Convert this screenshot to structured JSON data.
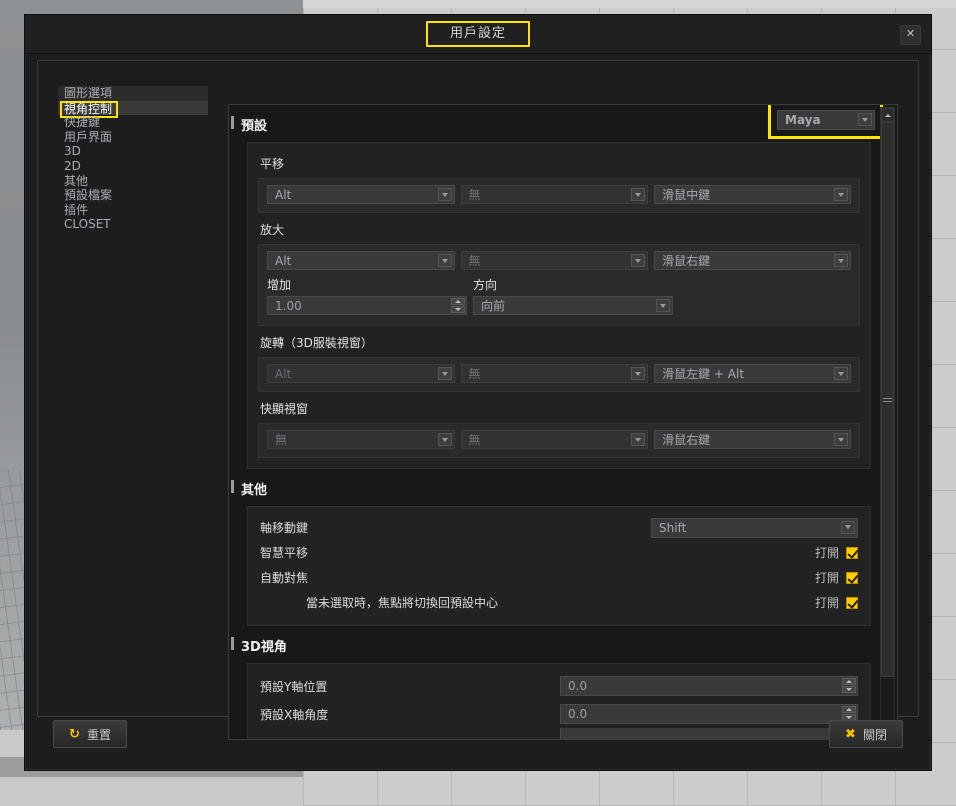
{
  "window": {
    "title": "用戶設定",
    "close_icon": "close-icon",
    "title_highlight_color": "#ffe400"
  },
  "sidebar": {
    "items": [
      {
        "label": "圖形選項",
        "selected": false
      },
      {
        "label": "視角控制",
        "selected": true
      },
      {
        "label": "快捷鍵",
        "selected": false
      },
      {
        "label": "用戶界面",
        "selected": false
      },
      {
        "label": "3D",
        "selected": false
      },
      {
        "label": "2D",
        "selected": false
      },
      {
        "label": "其他",
        "selected": false
      },
      {
        "label": "預設檔案",
        "selected": false
      },
      {
        "label": "插件",
        "selected": false
      },
      {
        "label": "CLOSET",
        "selected": false
      }
    ]
  },
  "preset": {
    "section_title": "預設",
    "value": "Maya",
    "highlight_color": "#ffe400"
  },
  "pan": {
    "title": "平移",
    "modifier1": "Alt",
    "modifier2": "無",
    "mouse": "滑鼠中鍵"
  },
  "zoom": {
    "title": "放大",
    "modifier1": "Alt",
    "modifier2": "無",
    "mouse": "滑鼠右鍵",
    "increment_label": "增加",
    "increment_value": "1.00",
    "direction_label": "方向",
    "direction_value": "向前"
  },
  "rotate": {
    "title": "旋轉（3D服裝視窗）",
    "modifier1": "Alt",
    "modifier2": "無",
    "mouse": "滑鼠左鍵 + Alt"
  },
  "popup": {
    "title": "快顯視窗",
    "modifier1": "無",
    "modifier2": "無",
    "mouse": "滑鼠右鍵"
  },
  "other": {
    "section_title": "其他",
    "axis_move_key_label": "軸移動鍵",
    "axis_move_key_value": "Shift",
    "rows": [
      {
        "label": "智慧平移",
        "state": "打開",
        "checked": true,
        "indent": false
      },
      {
        "label": "自動對焦",
        "state": "打開",
        "checked": true,
        "indent": false
      },
      {
        "label": "當未選取時，焦點將切換回預設中心",
        "state": "打開",
        "checked": true,
        "indent": true
      }
    ]
  },
  "view3d": {
    "section_title": "3D視角",
    "rows": [
      {
        "label": "預設Y軸位置",
        "value": "0.0"
      },
      {
        "label": "預設X軸角度",
        "value": "0.0"
      }
    ]
  },
  "footer": {
    "reset_label": "重置",
    "reset_icon": "refresh-icon",
    "close_label": "關閉",
    "close_icon": "x-icon"
  },
  "scrollbar": {
    "up_icon": "chevron-up-icon",
    "down_icon": "chevron-down-icon"
  }
}
